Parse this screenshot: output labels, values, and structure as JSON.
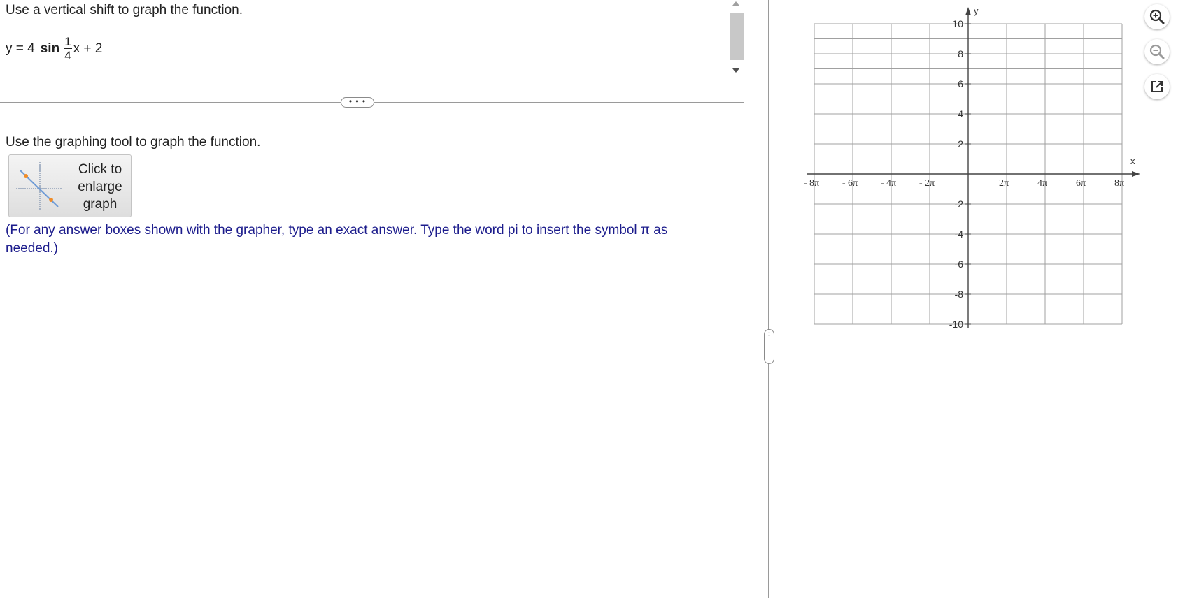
{
  "question": {
    "prompt": "Use a vertical shift to graph the function.",
    "formula": {
      "lhs": "y = 4",
      "func": "sin",
      "frac_num": "1",
      "frac_den": "4",
      "rhs": "x + 2"
    }
  },
  "divider_handle": "• • •",
  "instruction": "Use the graphing tool to graph the function.",
  "enlarge_button": {
    "label": "Click to\nenlarge\ngraph"
  },
  "note": "(For any answer boxes shown with the grapher, type an exact answer. Type the word pi to insert the symbol π as needed.)",
  "graph": {
    "x_axis_label": "x",
    "y_axis_label": "y",
    "x_ticks": [
      "- 8π",
      "- 6π",
      "- 4π",
      "- 2π",
      "2π",
      "4π",
      "6π",
      "8π"
    ],
    "y_ticks": [
      "10",
      "8",
      "6",
      "4",
      "2",
      "-2",
      "-4",
      "-6",
      "-8",
      "-10"
    ],
    "x_range": [
      -8,
      8
    ],
    "y_range": [
      -10,
      10
    ],
    "grid": true,
    "grid_color": "#a0a0a0"
  },
  "tools": [
    {
      "name": "zoom-in-icon"
    },
    {
      "name": "zoom-out-icon"
    },
    {
      "name": "popout-icon"
    }
  ],
  "colors": {
    "note": "#1c1c8c",
    "accent_point": "#f08c28",
    "line": "#6e9bd6"
  }
}
